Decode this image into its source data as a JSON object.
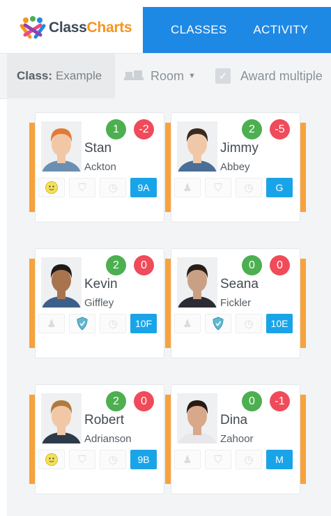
{
  "header": {
    "logo_class": "Class",
    "logo_charts": "Charts",
    "nav": [
      "CLASSES",
      "ACTIVITY"
    ]
  },
  "toolbar": {
    "class_label": "Class:",
    "class_value": "Example",
    "room_label": "Room",
    "award_label": "Award multiple"
  },
  "colors": {
    "brand_blue": "#1e88e5",
    "positive": "#4caf50",
    "negative": "#ef4b5a",
    "stripe": "#f7a23c",
    "form_badge": "#1aa4e8"
  },
  "students": [
    {
      "first": "Stan",
      "last": "Ackton",
      "pos": "1",
      "neg": "-2",
      "form": "9A",
      "icons": [
        "smiley-icon",
        "shield-icon",
        "clock-icon"
      ]
    },
    {
      "first": "Jimmy",
      "last": "Abbey",
      "pos": "2",
      "neg": "-5",
      "form": "G",
      "icons": [
        "trophy-icon",
        "shield-icon",
        "clock-icon"
      ]
    },
    {
      "first": "Kevin",
      "last": "Giffley",
      "pos": "2",
      "neg": "0",
      "form": "10F",
      "icons": [
        "trophy-icon",
        "shield-icon",
        "clock-icon"
      ]
    },
    {
      "first": "Seana",
      "last": "Fickler",
      "pos": "0",
      "neg": "0",
      "form": "10E",
      "icons": [
        "trophy-icon",
        "shield-icon",
        "clock-icon"
      ]
    },
    {
      "first": "Robert",
      "last": "Adrianson",
      "pos": "2",
      "neg": "0",
      "form": "9B",
      "icons": [
        "smiley-icon",
        "shield-icon",
        "clock-icon"
      ]
    },
    {
      "first": "Dina",
      "last": "Zahoor",
      "pos": "0",
      "neg": "-1",
      "form": "M",
      "icons": [
        "trophy-icon",
        "shield-icon",
        "clock-icon"
      ]
    }
  ]
}
